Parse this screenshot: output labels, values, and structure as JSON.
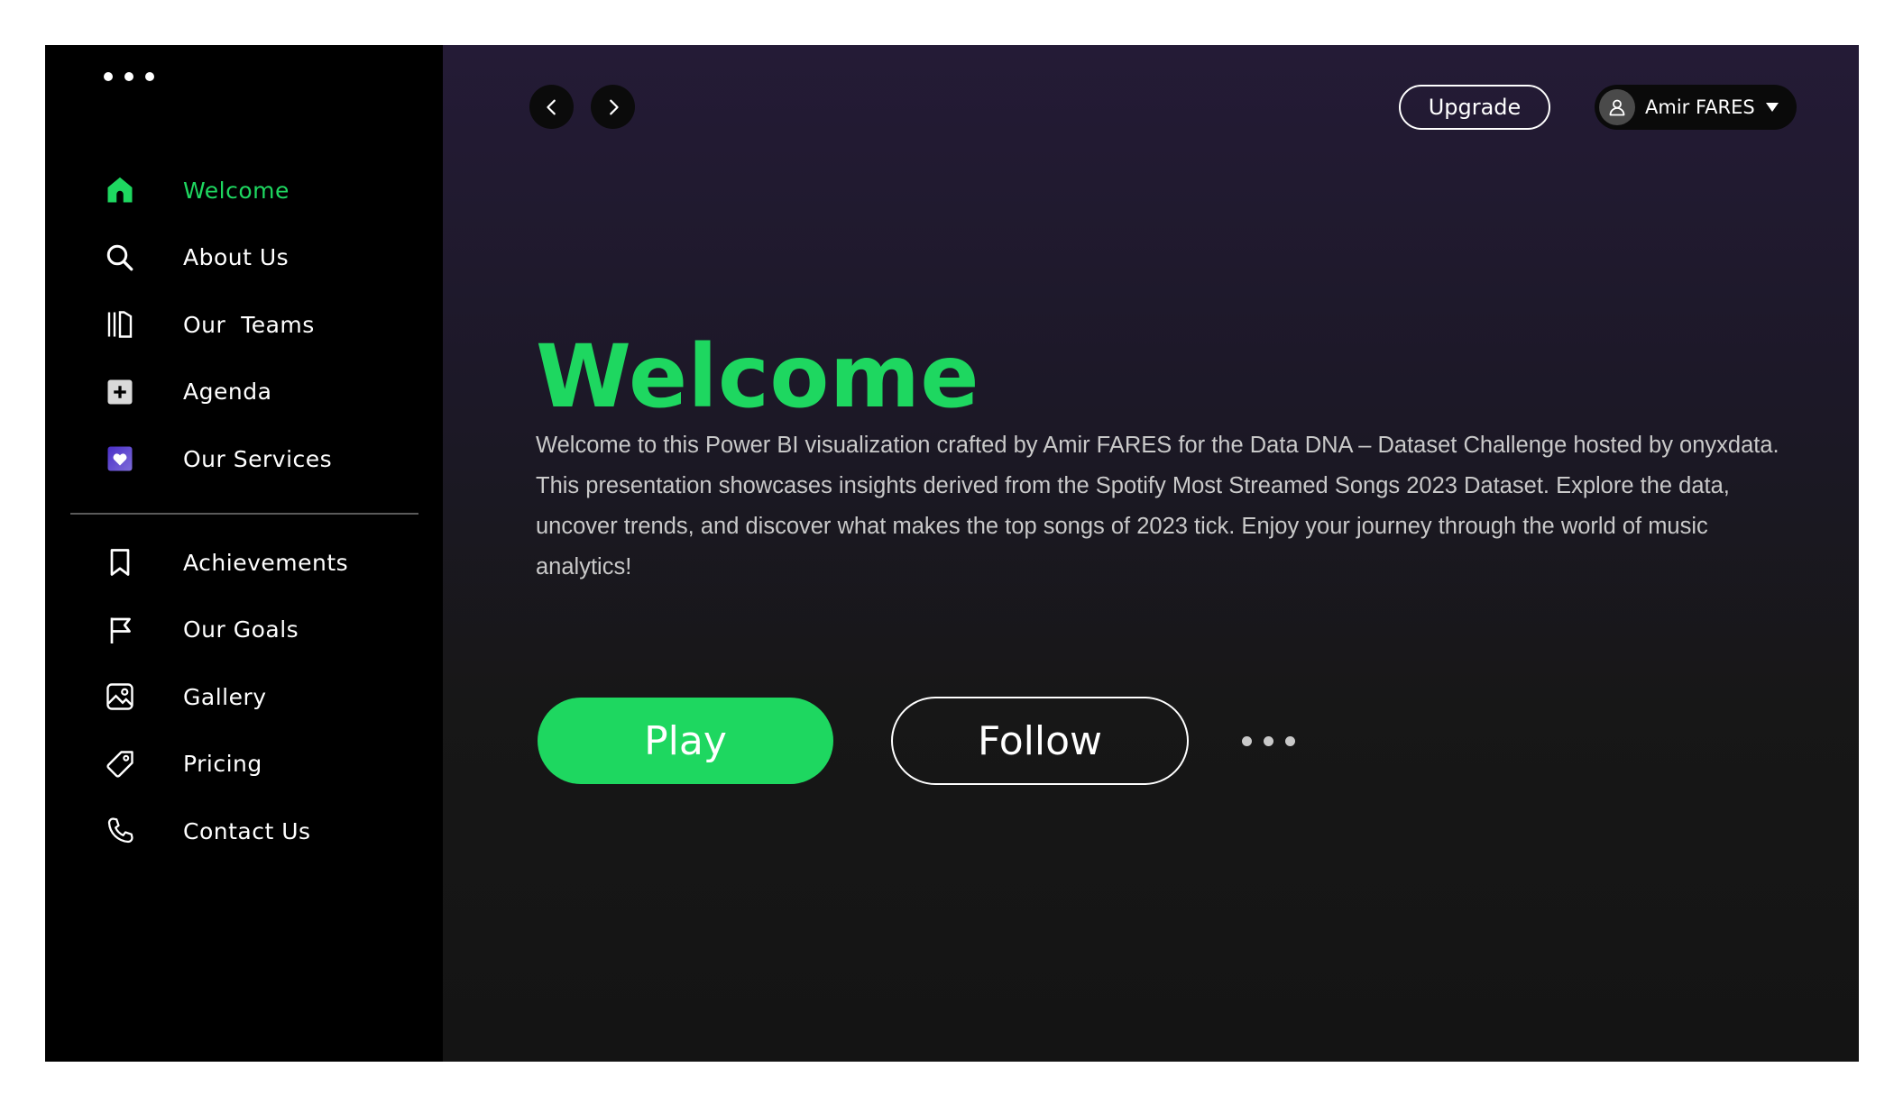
{
  "sidebar": {
    "primary_items": [
      {
        "label": "Welcome",
        "icon": "home-icon",
        "active": true
      },
      {
        "label": "About Us",
        "icon": "search-icon",
        "active": false
      },
      {
        "label": "Our  Teams",
        "icon": "library-icon",
        "active": false
      },
      {
        "label": "Agenda",
        "icon": "plus-square-icon",
        "active": false
      },
      {
        "label": "Our Services",
        "icon": "heart-square-icon",
        "active": false
      }
    ],
    "secondary_items": [
      {
        "label": "Achievements",
        "icon": "bookmark-icon"
      },
      {
        "label": "Our Goals",
        "icon": "flag-icon"
      },
      {
        "label": "Gallery",
        "icon": "image-icon"
      },
      {
        "label": "Pricing",
        "icon": "tag-icon"
      },
      {
        "label": "Contact Us",
        "icon": "phone-icon"
      }
    ]
  },
  "header": {
    "upgrade_label": "Upgrade",
    "user_name": "Amir FARES"
  },
  "hero": {
    "title": "Welcome",
    "description": "Welcome to this Power BI visualization crafted by Amir FARES for the Data DNA – Dataset Challenge hosted by onyxdata. This presentation showcases insights derived from the Spotify Most Streamed Songs 2023 Dataset. Explore the data, uncover trends, and discover what makes the top songs of 2023 tick. Enjoy your journey through the world of music analytics!",
    "play_label": "Play",
    "follow_label": "Follow"
  },
  "colors": {
    "accent": "#1ed760",
    "sidebar_bg": "#000000",
    "main_bg_top": "#241b36",
    "main_bg_bottom": "#141414"
  }
}
